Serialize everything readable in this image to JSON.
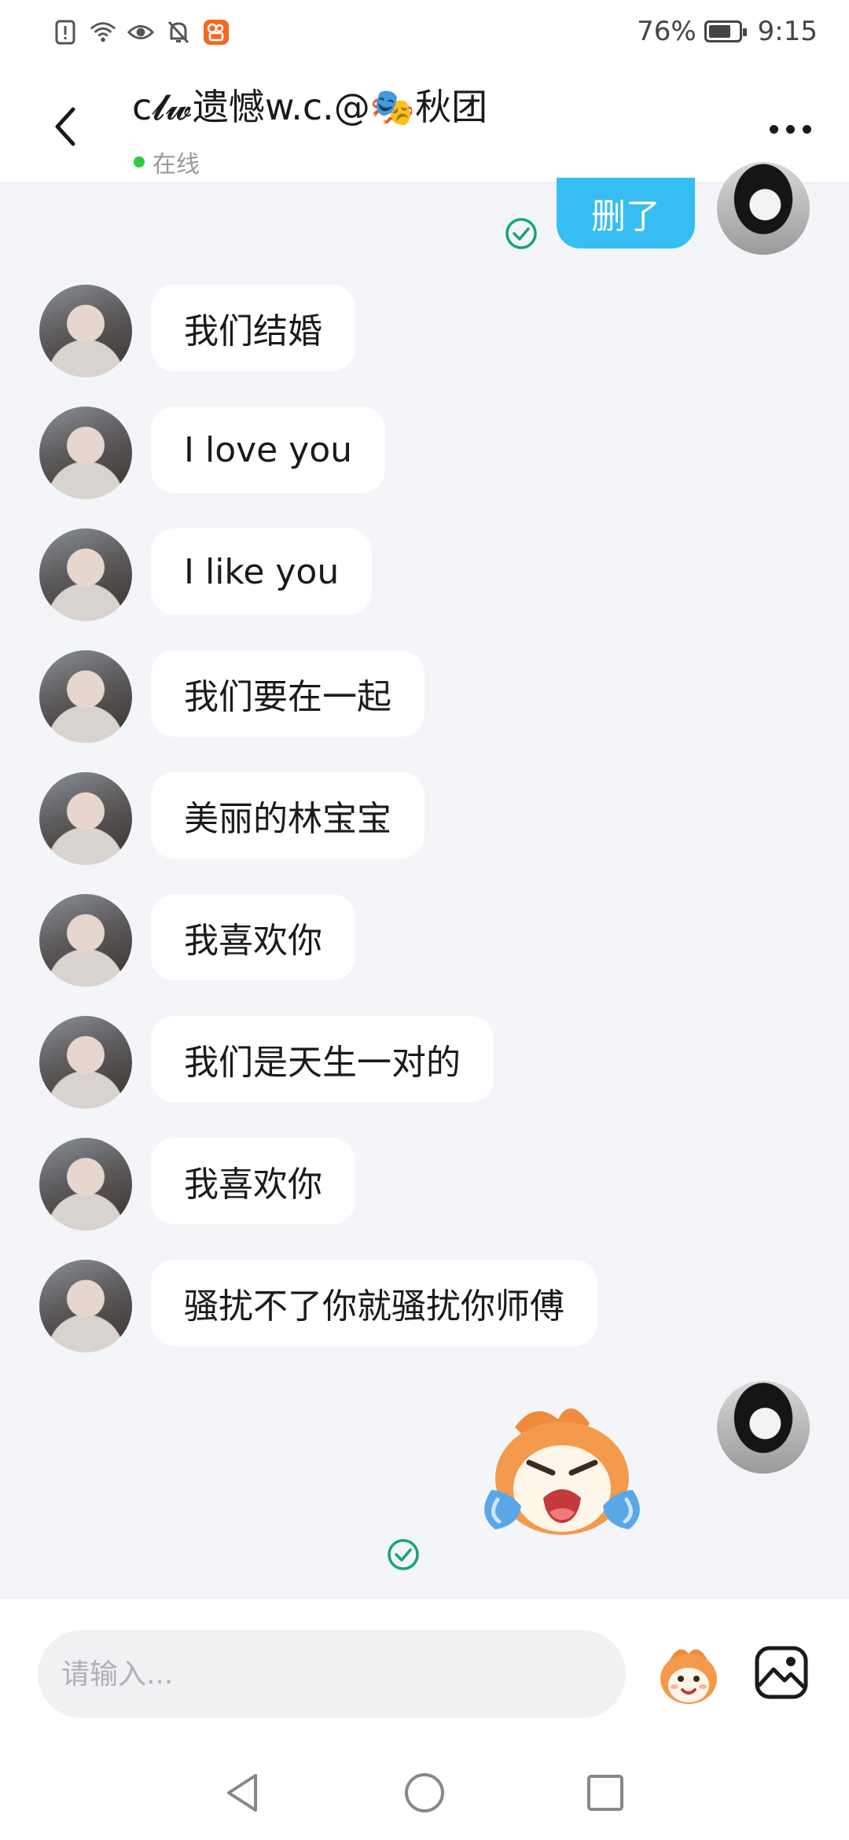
{
  "status_bar": {
    "battery": "76%",
    "battery_level": 0.76,
    "time": "9:15",
    "icons": [
      "alert-icon",
      "wifi-icon",
      "eye-icon",
      "mute-bell-icon",
      "app-notification-icon"
    ]
  },
  "header": {
    "title": "c𝓵𝔀遗憾w.c.@🎭秋团",
    "presence": "在线"
  },
  "messages": [
    {
      "sender": "self",
      "text": "删了",
      "read": true
    },
    {
      "sender": "other",
      "text": "我们结婚"
    },
    {
      "sender": "other",
      "text": "I love you"
    },
    {
      "sender": "other",
      "text": "I like you"
    },
    {
      "sender": "other",
      "text": "我们要在一起"
    },
    {
      "sender": "other",
      "text": "美丽的林宝宝"
    },
    {
      "sender": "other",
      "text": "我喜欢你"
    },
    {
      "sender": "other",
      "text": "我们是天生一对的"
    },
    {
      "sender": "other",
      "text": "我喜欢你"
    },
    {
      "sender": "other",
      "text": "骚扰不了你就骚扰你师傅"
    },
    {
      "sender": "self",
      "type": "sticker",
      "sticker": "crying-fox-sticker",
      "read": true
    }
  ],
  "input": {
    "placeholder": "请输入..."
  },
  "colors": {
    "accent": "#36bdf2",
    "online": "#2ecc40",
    "read_check": "#16a37a",
    "background": "#f4f5f9"
  }
}
